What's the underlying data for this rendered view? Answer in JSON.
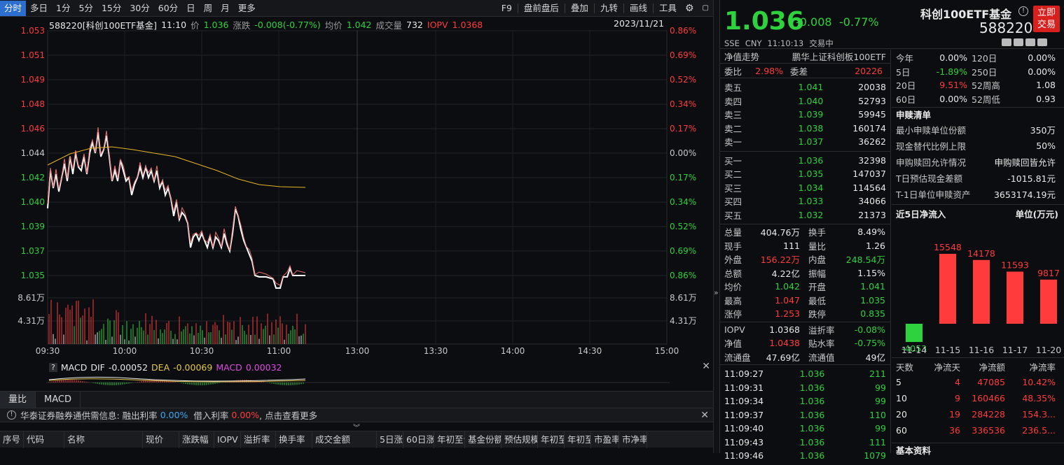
{
  "toolbar": {
    "tabs": [
      "分时",
      "多日",
      "1分",
      "5分",
      "15分",
      "30分",
      "60分",
      "日",
      "周",
      "月",
      "更多"
    ],
    "right": [
      "F9",
      "盘前盘后",
      "叠加",
      "九转",
      "画线",
      "工具"
    ]
  },
  "chart": {
    "code_name": "588220[科创100ETF基金]",
    "time": "11:10",
    "price_label": "价",
    "price": "1.036",
    "chg_label": "涨跌",
    "chg": "-0.008(-0.77%)",
    "avg_label": "均价",
    "avg": "1.042",
    "vol_label": "成交量",
    "vol": "732",
    "iopv_label": "IOPV",
    "iopv": "1.0368",
    "date": "2023/11/21",
    "y_left": [
      "1.053",
      "1.051",
      "1.049",
      "1.048",
      "1.046",
      "1.044",
      "1.042",
      "1.040",
      "1.039",
      "1.037",
      "1.035"
    ],
    "y_right": [
      "0.86%",
      "0.69%",
      "0.52%",
      "0.34%",
      "0.17%",
      "0.00%",
      "0.17%",
      "0.34%",
      "0.52%",
      "0.69%",
      "0.86%"
    ],
    "vol_labels": [
      "8.61万",
      "4.31万"
    ],
    "x_labels": [
      "09:30",
      "10:00",
      "10:30",
      "11:00",
      "13:00",
      "13:30",
      "14:00",
      "14:30",
      "15:00"
    ]
  },
  "macd": {
    "label": "MACD",
    "dif_label": "DIF",
    "dif": "-0.00052",
    "dea_label": "DEA",
    "dea": "-0.00069",
    "macd_label": "MACD",
    "macd": "0.00032"
  },
  "bottom_tabs": [
    "量比",
    "MACD"
  ],
  "notice": {
    "text": "华泰证券融券通供需信息: 融出利率",
    "rate1": "0.00%",
    "mid": "借入利率",
    "rate2": "0.00%",
    "tail": ", 点击查看更多"
  },
  "table_headers": [
    "序号",
    "代码",
    "名称",
    "现价",
    "涨跌幅",
    "IOPV",
    "溢折率",
    "换手率",
    "成交金额",
    "5日涨",
    "60日涨",
    "年初至今",
    "基金份额",
    "预估规模",
    "年初至今",
    "年初至",
    "市盈率",
    "市净率"
  ],
  "quote": {
    "price": "1.036",
    "chg": "-0.008",
    "pct": "-0.77%",
    "name": "科创100ETF基金",
    "code": "588220",
    "trade_btn": "立即交易",
    "market": "SSE",
    "currency": "CNY",
    "time": "11:10:13",
    "status": "交易中"
  },
  "netvalue": {
    "label": "净值走势",
    "fund": "鹏华上证科创板100ETF"
  },
  "weibi": {
    "l1": "委比",
    "v1": "2.98%",
    "l2": "委差",
    "v2": "20226"
  },
  "sells": [
    {
      "label": "卖五",
      "price": "1.041",
      "vol": "20038"
    },
    {
      "label": "卖四",
      "price": "1.040",
      "vol": "52793"
    },
    {
      "label": "卖三",
      "price": "1.039",
      "vol": "59945"
    },
    {
      "label": "卖二",
      "price": "1.038",
      "vol": "160174"
    },
    {
      "label": "卖一",
      "price": "1.037",
      "vol": "36262"
    }
  ],
  "buys": [
    {
      "label": "买一",
      "price": "1.036",
      "vol": "32398"
    },
    {
      "label": "买二",
      "price": "1.035",
      "vol": "147037"
    },
    {
      "label": "买三",
      "price": "1.034",
      "vol": "114564"
    },
    {
      "label": "买四",
      "price": "1.033",
      "vol": "34066"
    },
    {
      "label": "买五",
      "price": "1.032",
      "vol": "21373"
    }
  ],
  "stats": [
    {
      "l1": "总量",
      "v1": "404.76万",
      "l2": "换手",
      "v2": "8.49%"
    },
    {
      "l1": "现手",
      "v1": "111",
      "l2": "量比",
      "v2": "1.26"
    },
    {
      "l1": "外盘",
      "v1": "156.22万",
      "l2": "内盘",
      "v2": "248.54万"
    },
    {
      "l1": "总额",
      "v1": "4.22亿",
      "l2": "振幅",
      "v2": "1.15%"
    },
    {
      "l1": "均价",
      "v1": "1.042",
      "l2": "开盘",
      "v2": "1.041"
    },
    {
      "l1": "最高",
      "v1": "1.047",
      "l2": "最低",
      "v2": "1.035"
    },
    {
      "l1": "涨停",
      "v1": "1.253",
      "l2": "跌停",
      "v2": "0.835"
    }
  ],
  "iopv_stats": [
    {
      "l1": "IOPV",
      "v1": "1.0368",
      "l2": "溢折率",
      "v2": "-0.08%"
    },
    {
      "l1": "净值",
      "v1": "1.0438",
      "l2": "贴水率",
      "v2": "-0.75%"
    },
    {
      "l1": "流通盘",
      "v1": "47.69亿",
      "l2": "流通值",
      "v2": "49亿"
    }
  ],
  "ticks": [
    {
      "t": "11:09:27",
      "p": "1.036",
      "v": "211"
    },
    {
      "t": "11:09:31",
      "p": "1.036",
      "v": "99"
    },
    {
      "t": "11:09:34",
      "p": "1.036",
      "v": "99"
    },
    {
      "t": "11:09:37",
      "p": "1.036",
      "v": "110"
    },
    {
      "t": "11:09:40",
      "p": "1.036",
      "v": "99"
    },
    {
      "t": "11:09:43",
      "p": "1.036",
      "v": "111"
    },
    {
      "t": "11:09:46",
      "p": "1.036",
      "v": "1079"
    }
  ],
  "perf": [
    {
      "l1": "今年",
      "v1": "0.00%",
      "l2": "120日",
      "v2": "0.00%"
    },
    {
      "l1": "5日",
      "v1": "-1.89%",
      "l2": "250日",
      "v2": "0.00%"
    },
    {
      "l1": "20日",
      "v1": "9.51%",
      "l2": "52周高",
      "v2": "1.08"
    },
    {
      "l1": "60日",
      "v1": "0.00%",
      "l2": "52周低",
      "v2": "0.93"
    }
  ],
  "shengshu": {
    "title": "申赎清单",
    "rows": [
      {
        "l": "最小申赎单位份额",
        "v": "350万"
      },
      {
        "l": "现金替代比例上限",
        "v": "50%"
      },
      {
        "l": "申购赎回允许情况",
        "v": "申购赎回皆允许"
      },
      {
        "l": "T日预估现金差额",
        "v": "-1015.81元"
      },
      {
        "l": "T-1日单位申赎资产",
        "v": "3653174.19元"
      }
    ]
  },
  "netflow": {
    "title": "近5日净流入",
    "unit": "单位(万元)",
    "chart_data": {
      "type": "bar",
      "categories": [
        "11-14",
        "11-15",
        "11-16",
        "11-17",
        "11-20"
      ],
      "values": [
        -4053,
        15548,
        14178,
        11593,
        9817
      ]
    }
  },
  "flow_table": {
    "headers": [
      "天数",
      "净流天",
      "净流额",
      "净流率"
    ],
    "rows": [
      {
        "d": "5",
        "n": "4",
        "a": "47085",
        "r": "10.42%"
      },
      {
        "d": "10",
        "n": "9",
        "a": "160466",
        "r": "48.35%"
      },
      {
        "d": "20",
        "n": "19",
        "a": "284228",
        "r": "154.3..."
      },
      {
        "d": "60",
        "n": "36",
        "a": "336536",
        "r": "236.5..."
      }
    ]
  },
  "basic": {
    "title": "基本资料"
  },
  "colors": {
    "up": "#ff3b3b",
    "down": "#2ed13e",
    "accent": "#2c6fd0",
    "avg_line": "#e6b422"
  }
}
